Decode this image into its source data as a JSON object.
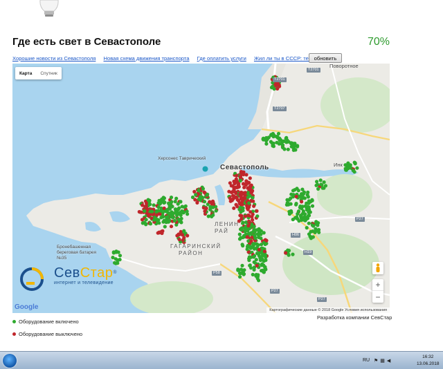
{
  "page": {
    "title": "Где есть свет в Севастополе",
    "percent": "70%"
  },
  "links": [
    "Хорошие новости из Севастополя",
    "Новая схема движения транспорта",
    "Где оплатить услуги",
    "Жил ли ты в СССР: тест"
  ],
  "refresh_label": "обновить",
  "map": {
    "type_buttons": [
      "Карта",
      "Спутник"
    ],
    "labels": {
      "city": "Севастополь",
      "chersonesos": "Херсонес Таврический",
      "battery": "Бронебашенная береговая батарея №35",
      "gagarin_line1": "ГАГАРИНСКИЙ",
      "gagarin_line2": "РАЙОН",
      "lenin_line1": "ЛЕНИН",
      "lenin_line2": "РАЙ",
      "povorotnoe": "Поворотное",
      "inkerman": "Инк"
    },
    "roads": [
      "T2701",
      "T2701",
      "T2707",
      "H19",
      "H06",
      "P27",
      "P27",
      "P58",
      "P27"
    ],
    "zoom_in": "+",
    "zoom_out": "−",
    "google": "Google",
    "attribution": "Картографические данные © 2018 Google   Условия использования"
  },
  "brand": {
    "name_part1": "Сев",
    "name_part2": "Стар",
    "registered": "®",
    "tagline": "интернет и телевидение"
  },
  "developer": "Разработка компании СевСтар",
  "legend": [
    {
      "label": "Оборудование включено",
      "color": "#2eaa2e"
    },
    {
      "label": "Оборудование выключено",
      "color": "#c0262b"
    }
  ],
  "taskbar": {
    "language": "RU",
    "time": "16:32",
    "date": "13.06.2018"
  }
}
